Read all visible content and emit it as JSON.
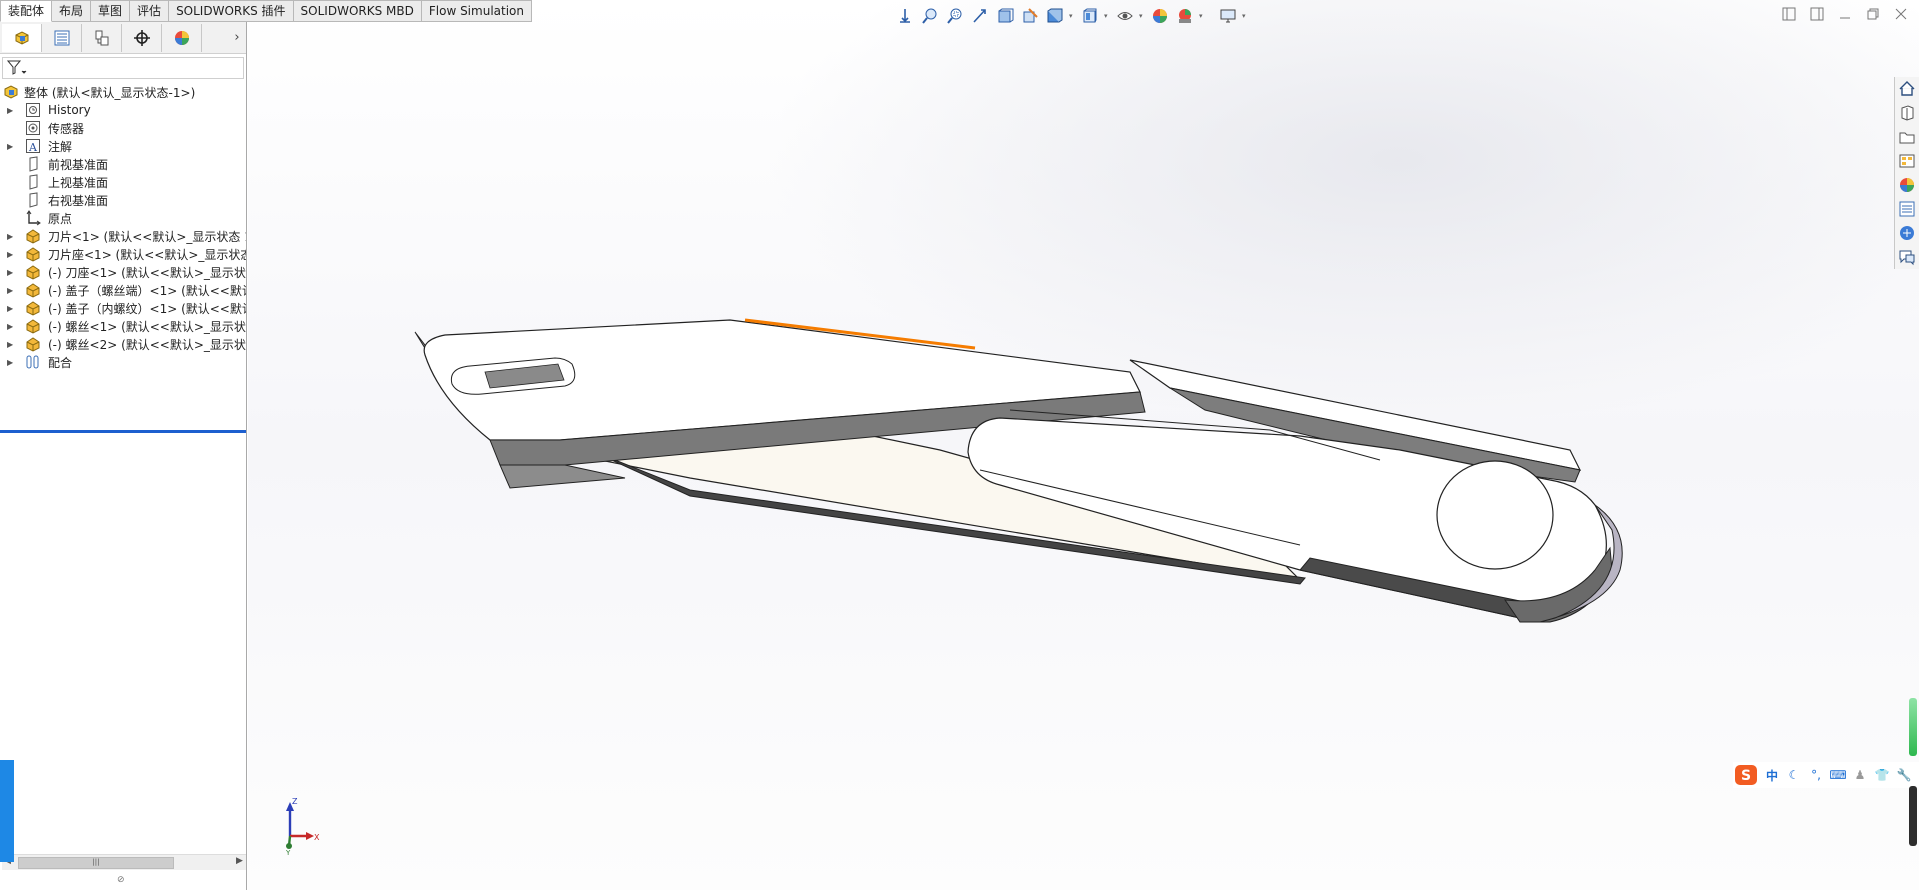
{
  "tabs": [
    {
      "label": "装配体",
      "active": true
    },
    {
      "label": "布局",
      "active": false
    },
    {
      "label": "草图",
      "active": false
    },
    {
      "label": "评估",
      "active": false
    },
    {
      "label": "SOLIDWORKS 插件",
      "active": false
    },
    {
      "label": "SOLIDWORKS MBD",
      "active": false
    },
    {
      "label": "Flow Simulation",
      "active": false
    }
  ],
  "feature_tree": {
    "root": "整体 (默认<默认_显示状态-1>)",
    "items": [
      {
        "label": "History",
        "icon": "history-icon",
        "expandable": true
      },
      {
        "label": "传感器",
        "icon": "sensor-icon",
        "expandable": false
      },
      {
        "label": "注解",
        "icon": "annotation-icon",
        "expandable": true
      },
      {
        "label": "前视基准面",
        "icon": "plane-icon",
        "expandable": false
      },
      {
        "label": "上视基准面",
        "icon": "plane-icon",
        "expandable": false
      },
      {
        "label": "右视基准面",
        "icon": "plane-icon",
        "expandable": false
      },
      {
        "label": "原点",
        "icon": "origin-icon",
        "expandable": false
      },
      {
        "label": "刀片<1> (默认<<默认>_显示状态 1",
        "icon": "part-icon",
        "expandable": true
      },
      {
        "label": "刀片座<1> (默认<<默认>_显示状态",
        "icon": "part-icon",
        "expandable": true
      },
      {
        "label": "(-) 刀座<1> (默认<<默认>_显示状态",
        "icon": "part-icon",
        "expandable": true
      },
      {
        "label": "(-) 盖子（螺丝端）<1> (默认<<默认",
        "icon": "part-icon",
        "expandable": true
      },
      {
        "label": "(-) 盖子（内螺纹）<1> (默认<<默认",
        "icon": "part-icon",
        "expandable": true
      },
      {
        "label": "(-) 螺丝<1> (默认<<默认>_显示状态",
        "icon": "part-icon",
        "expandable": true
      },
      {
        "label": "(-) 螺丝<2> (默认<<默认>_显示状态",
        "icon": "part-icon",
        "expandable": true
      },
      {
        "label": "配合",
        "icon": "mates-icon",
        "expandable": true
      }
    ]
  },
  "fm_tabs": [
    "feature-manager-icon",
    "property-manager-icon",
    "configuration-manager-icon",
    "dimxpert-icon",
    "display-manager-icon"
  ],
  "hud_icons": [
    "view-orientation-icon",
    "zoom-to-fit-icon",
    "zoom-area-icon",
    "previous-view-icon",
    "section-view-icon",
    "dynamic-annotation-icon",
    "view-settings-icon",
    "display-style-icon",
    "hide-show-icon",
    "edit-appearance-icon",
    "apply-scene-icon",
    "view-setting-monitor-icon"
  ],
  "task_pane_icons": [
    "home-icon",
    "design-library-icon",
    "file-explorer-icon",
    "view-palette-icon",
    "appearances-icon",
    "custom-properties-icon",
    "solidworks-forum-icon",
    "feedback-icon"
  ],
  "ime": {
    "label": "中",
    "icons": [
      "sogou-icon",
      "moon-icon",
      "punctuation-icon",
      "keyboard-icon",
      "user-icon",
      "skin-icon",
      "tools-icon"
    ]
  },
  "triad": {
    "z": "Z",
    "x": "X",
    "y": "Y"
  },
  "colors": {
    "accent": "#1d5fcf",
    "selected_edge": "#f57c00",
    "tab_bg": "#ececec"
  }
}
